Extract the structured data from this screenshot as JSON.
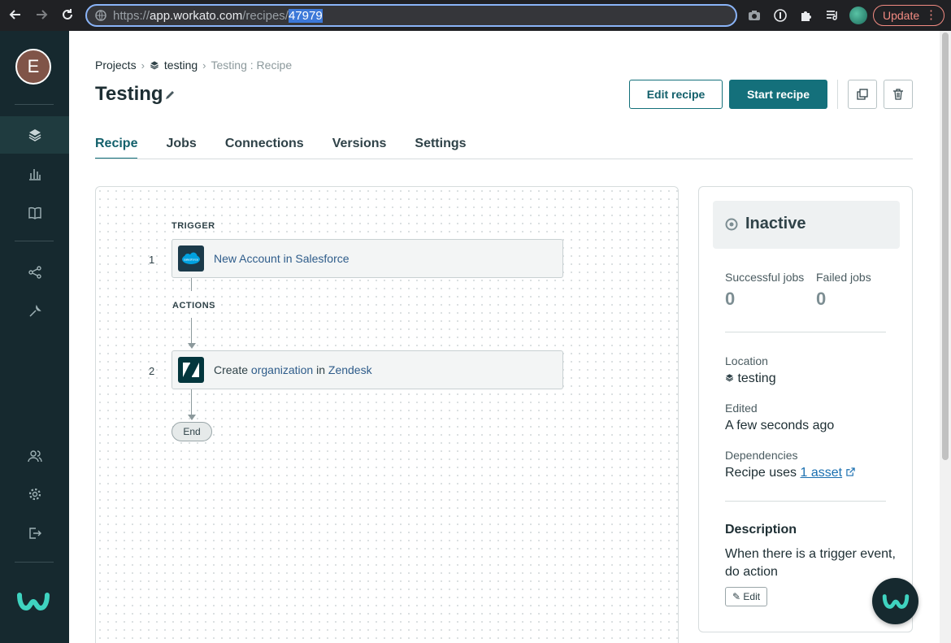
{
  "browser": {
    "url_scheme": "https://",
    "url_host": "app.workato.com",
    "url_path": "/recipes/",
    "url_selected": "47979",
    "update_label": "Update"
  },
  "sidebar": {
    "avatar_initial": "E",
    "items": [
      {
        "icon": "layers-icon",
        "active": true
      },
      {
        "icon": "bar-chart-icon",
        "active": false
      },
      {
        "icon": "book-icon",
        "active": false
      },
      {
        "icon": "share-nodes-icon",
        "active": false
      },
      {
        "icon": "wrench-icon",
        "active": false
      },
      {
        "icon": "users-icon",
        "active": false
      },
      {
        "icon": "gear-icon",
        "active": false
      },
      {
        "icon": "logout-icon",
        "active": false
      }
    ]
  },
  "breadcrumb": {
    "projects": "Projects",
    "folder": "testing",
    "current": "Testing : Recipe"
  },
  "header": {
    "title": "Testing",
    "edit_recipe": "Edit recipe",
    "start_recipe": "Start recipe"
  },
  "tabs": [
    "Recipe",
    "Jobs",
    "Connections",
    "Versions",
    "Settings"
  ],
  "recipe": {
    "trigger_label": "TRIGGER",
    "actions_label": "ACTIONS",
    "step1_number": "1",
    "step1_text_a": "New Account in Salesforce",
    "step1_logo_text": "salesforce",
    "step2_number": "2",
    "step2_text_a": "Create ",
    "step2_link_a": "organization",
    "step2_text_b": " in ",
    "step2_link_b": "Zendesk",
    "end_label": "End"
  },
  "panel": {
    "status": "Inactive",
    "successful_label": "Successful jobs",
    "successful_value": "0",
    "failed_label": "Failed jobs",
    "failed_value": "0",
    "location_label": "Location",
    "location_value": "testing",
    "edited_label": "Edited",
    "edited_value": "A few seconds ago",
    "dependencies_label": "Dependencies",
    "dependencies_text": "Recipe uses ",
    "dependencies_link": "1 asset",
    "description_title": "Description",
    "description_text": "When there is a trigger event, do action",
    "edit_label": "Edit"
  },
  "colors": {
    "sidebar_bg": "#16292f",
    "accent": "#14707b",
    "link": "#2e5c8a"
  }
}
